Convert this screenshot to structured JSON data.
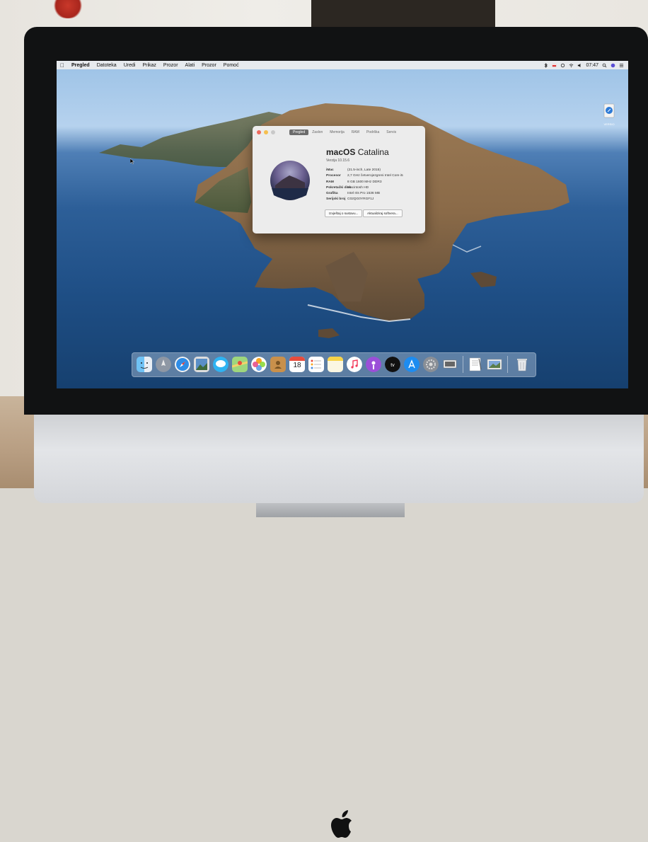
{
  "menubar": {
    "items": [
      "Pregled",
      "Datoteka",
      "Uredi",
      "Prikaz",
      "Prozor",
      "Alati",
      "Prozor",
      "Pomoć"
    ],
    "time": "07:47"
  },
  "about_window": {
    "tabs": [
      "Pregled",
      "Zaslon",
      "Memorija",
      "RAM",
      "Podrška",
      "Servis"
    ],
    "os_name": "macOS",
    "os_release": "Catalina",
    "version": "Verzija 10.15.6",
    "specs": [
      {
        "label": "iMac",
        "value": "(21.5-inch, Late 2015)"
      },
      {
        "label": "Procesor",
        "value": "2,7 GHz četverojezgreni Intel Core i5"
      },
      {
        "label": "RAM",
        "value": "8 GB 1600 MHz DDR3"
      },
      {
        "label": "Pokretački disk",
        "value": "Macintosh HD"
      },
      {
        "label": "Grafika",
        "value": "Intel Iris Pro 1536 MB"
      },
      {
        "label": "Serijski broj",
        "value": "C02QG0YRGF1J"
      }
    ],
    "buttons": {
      "report": "Izvještaj o sustavu...",
      "update": "Aktualiziraj softvera..."
    }
  },
  "dock": {
    "apps": [
      "finder-icon",
      "launchpad-icon",
      "safari-icon",
      "photo-preview-icon",
      "messages-icon",
      "maps-icon",
      "photos-icon",
      "contacts-icon",
      "calendar-icon",
      "reminders-icon",
      "notes-icon",
      "music-icon",
      "podcasts-icon",
      "apple-tv-icon",
      "app-store-icon",
      "system-preferences-icon",
      "keynote-icon",
      "textedit-icon",
      "image-viewer-icon",
      "trash-icon"
    ],
    "calendar_day": "18"
  },
  "desktop": {
    "file_label": "VERSIO"
  },
  "colors": {
    "menubar_bg": "#ececee",
    "active_tab": "#6b6b6b",
    "close": "#ed6a5e",
    "minimize": "#f5bf4f",
    "maximize": "#c9c9c9"
  }
}
